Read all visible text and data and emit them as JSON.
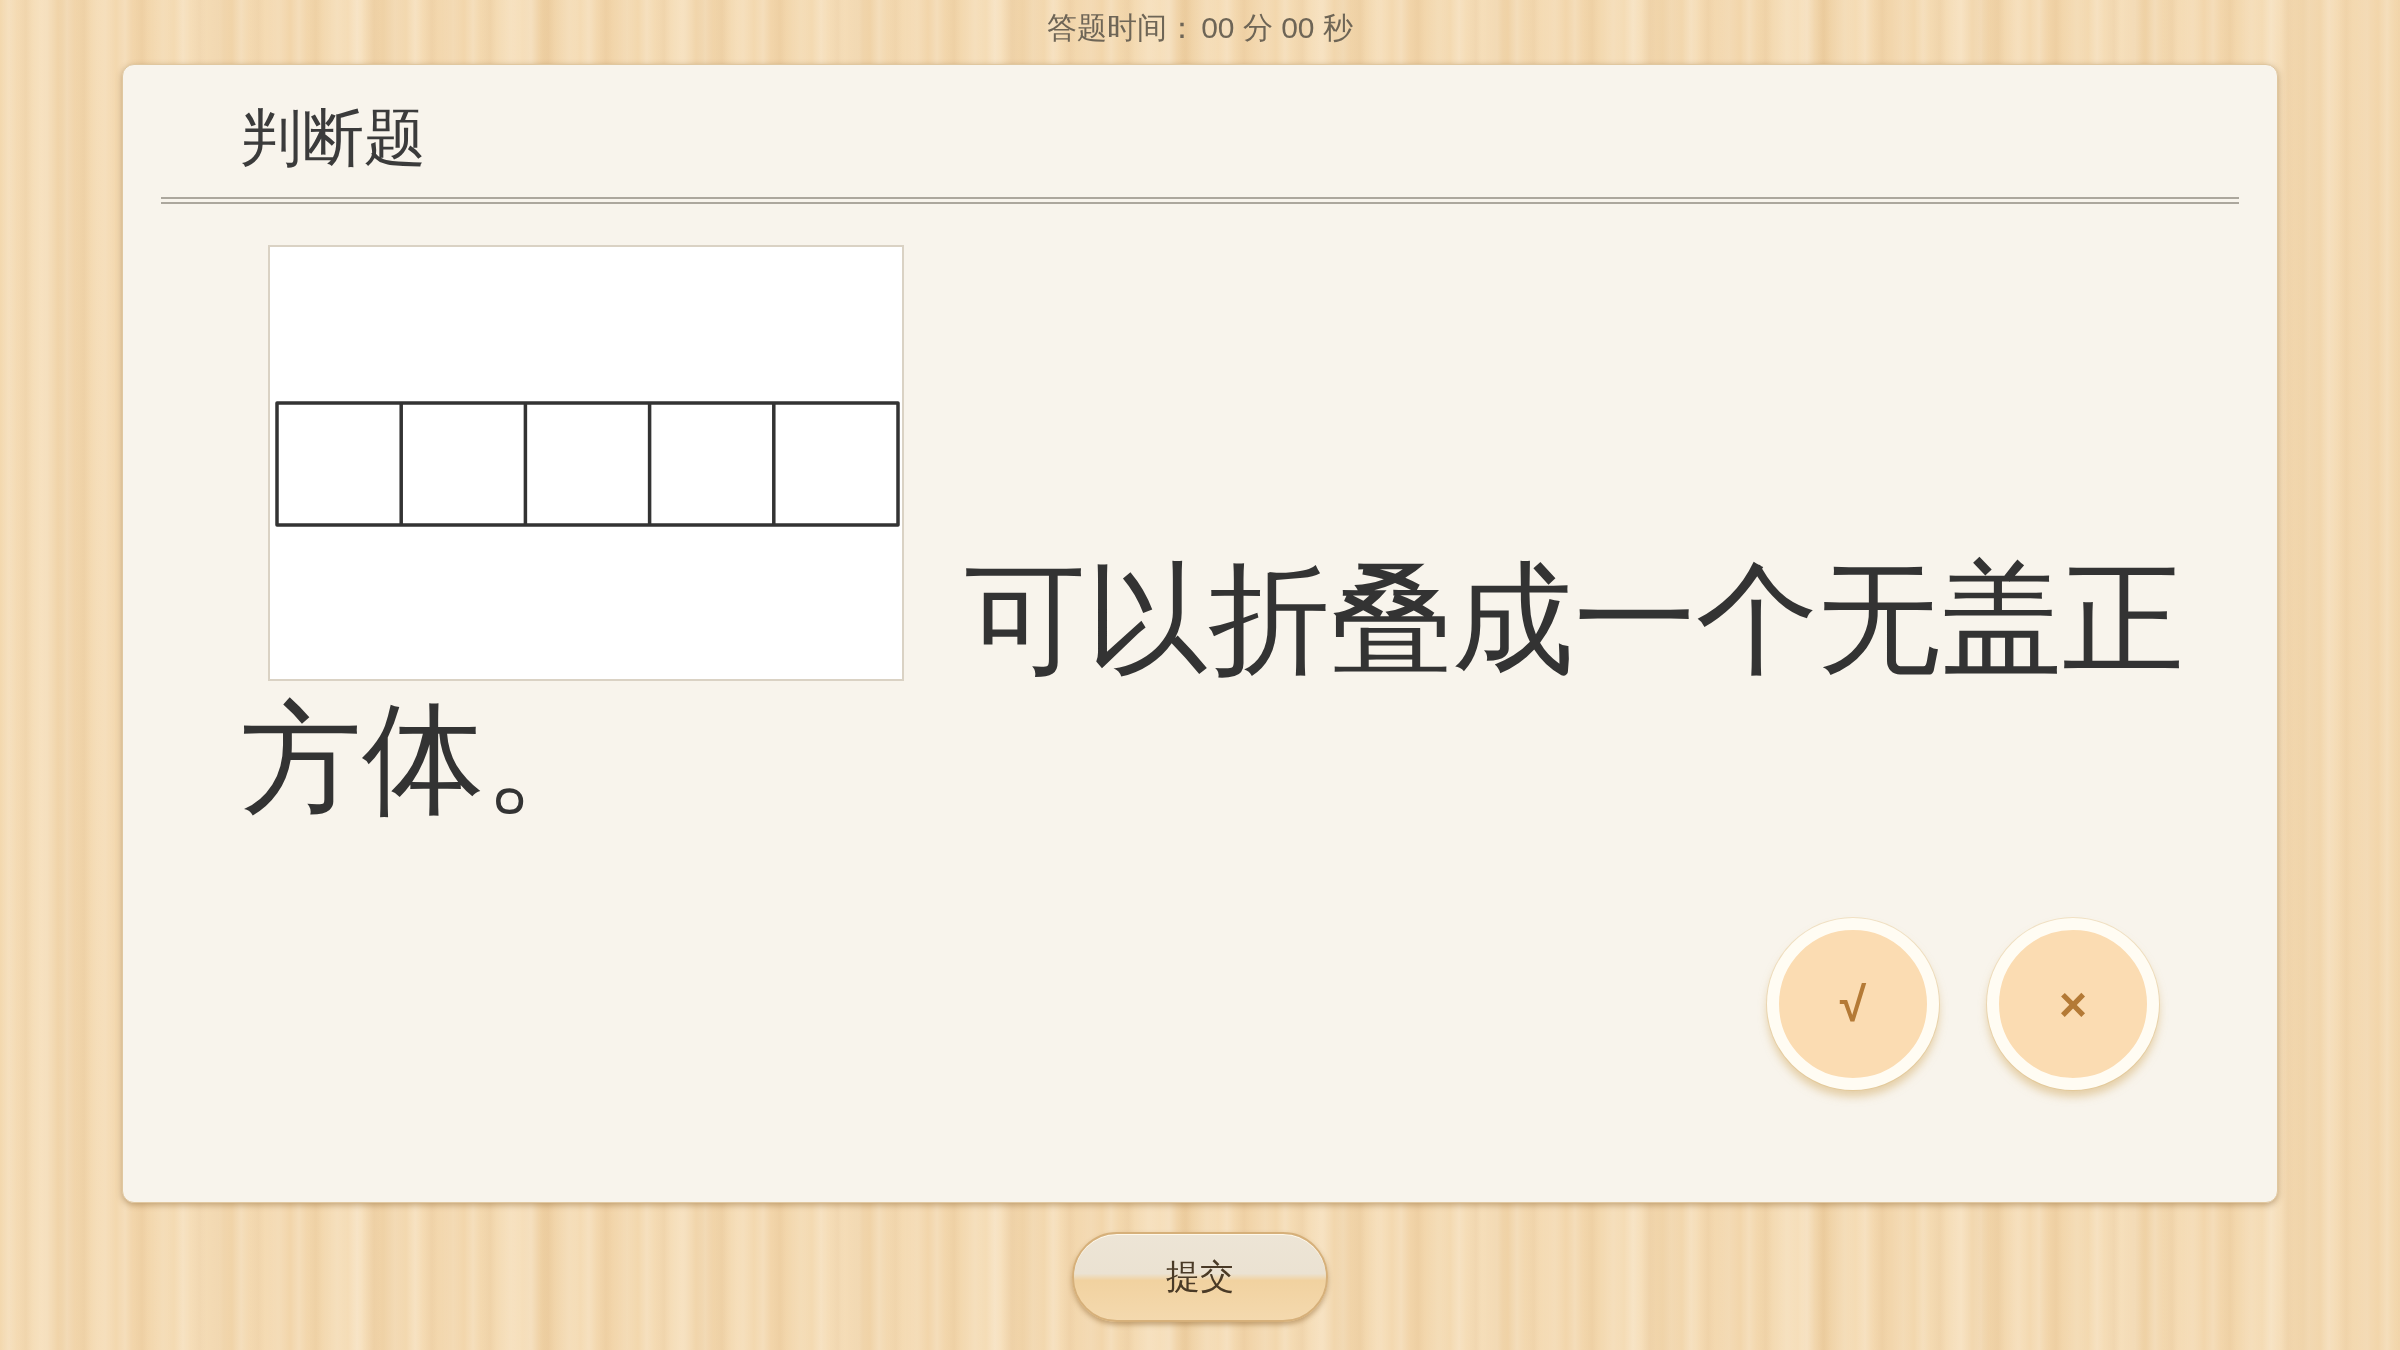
{
  "timer": {
    "label": "答题时间：",
    "value": "00 分 00 秒"
  },
  "card": {
    "title": "判断题",
    "question": {
      "text": "可以折叠成一个无盖正方体。"
    },
    "answers": [
      {
        "label": "√",
        "selected": false
      },
      {
        "label": "×",
        "selected": false
      }
    ]
  },
  "submit_button": {
    "label": "提交"
  }
}
